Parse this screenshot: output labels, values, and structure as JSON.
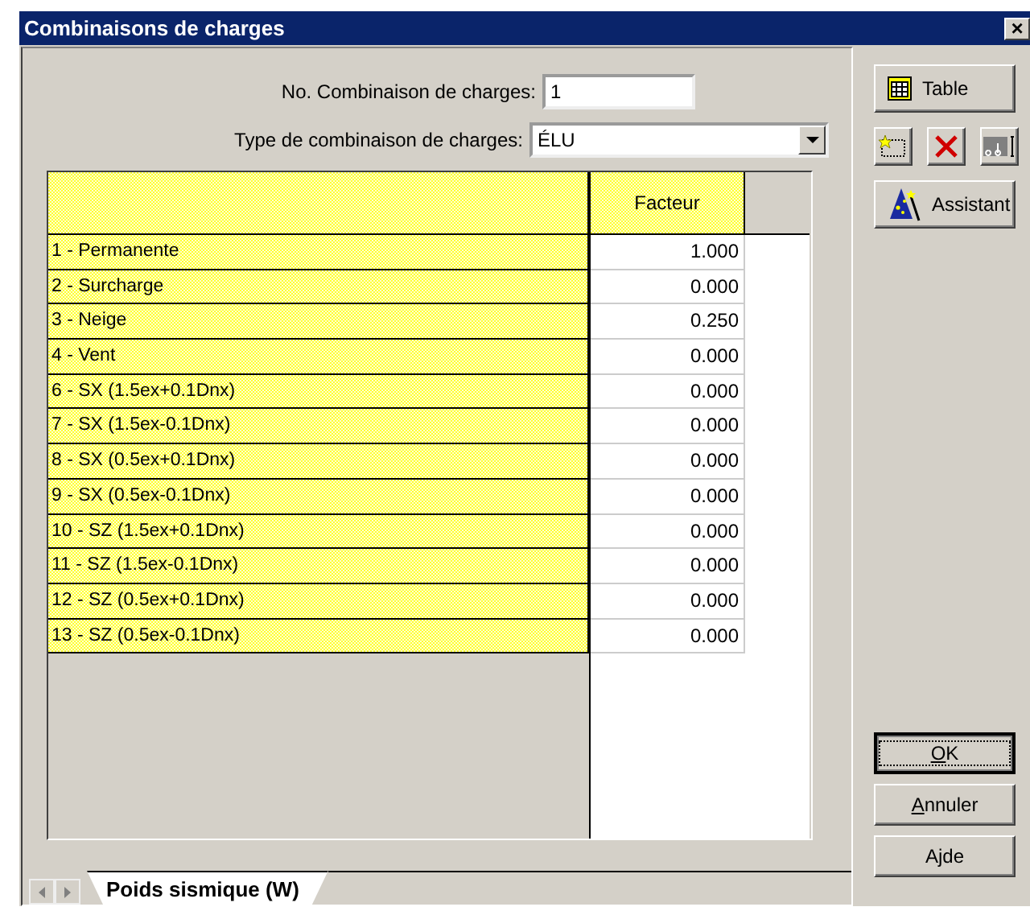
{
  "window": {
    "title": "Combinaisons de charges",
    "close": "×"
  },
  "form": {
    "number_label": "No. Combinaison de charges:",
    "number_value": "1",
    "type_label": "Type de combinaison de charges:",
    "type_value": "ÉLU"
  },
  "table": {
    "columns": [
      "Facteur"
    ],
    "rows": [
      {
        "name": "1 - Permanente",
        "factor": "1.000"
      },
      {
        "name": "2 - Surcharge",
        "factor": "0.000"
      },
      {
        "name": "3 - Neige",
        "factor": "0.250"
      },
      {
        "name": "4 - Vent",
        "factor": "0.000"
      },
      {
        "name": "6 - SX (1.5ex+0.1Dnx)",
        "factor": "0.000"
      },
      {
        "name": "7 - SX (1.5ex-0.1Dnx)",
        "factor": "0.000"
      },
      {
        "name": "8 - SX (0.5ex+0.1Dnx)",
        "factor": "0.000"
      },
      {
        "name": "9 - SX (0.5ex-0.1Dnx)",
        "factor": "0.000"
      },
      {
        "name": "10 - SZ (1.5ex+0.1Dnx)",
        "factor": "0.000"
      },
      {
        "name": "11 - SZ (1.5ex-0.1Dnx)",
        "factor": "0.000"
      },
      {
        "name": "12 - SZ (0.5ex+0.1Dnx)",
        "factor": "0.000"
      },
      {
        "name": "13 - SZ (0.5ex-0.1Dnx)",
        "factor": "0.000"
      }
    ]
  },
  "tools": [
    {
      "kind": "table",
      "label": "Table"
    },
    {
      "kind": "new"
    },
    {
      "kind": "delete"
    },
    {
      "kind": "rename"
    },
    {
      "kind": "wizard",
      "label": "Assistant"
    }
  ],
  "buttons": [
    {
      "key": "O",
      "after": "K",
      "default": true
    },
    {
      "key": "A",
      "after": "nnuler",
      "default": false
    },
    {
      "before": "A",
      "key": "j",
      "after": "de",
      "default": false
    }
  ],
  "tabs": [
    {
      "label": "Poids sismique (W)",
      "selected": true
    }
  ]
}
